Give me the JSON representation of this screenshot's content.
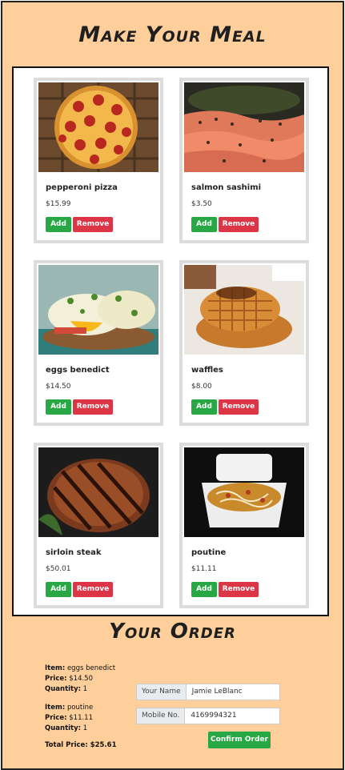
{
  "header": {
    "title": "Make Your Meal"
  },
  "menu": {
    "add_label": "Add",
    "remove_label": "Remove",
    "items": [
      {
        "name": "pepperoni pizza",
        "price": "$15.99"
      },
      {
        "name": "salmon sashimi",
        "price": "$3.50"
      },
      {
        "name": "eggs benedict",
        "price": "$14.50"
      },
      {
        "name": "waffles",
        "price": "$8.00"
      },
      {
        "name": "sirloin steak",
        "price": "$50.01"
      },
      {
        "name": "poutine",
        "price": "$11.11"
      }
    ]
  },
  "order": {
    "title": "Your Order",
    "item_label": "Item:",
    "price_label": "Price:",
    "quantity_label": "Quantity:",
    "lines": [
      {
        "item": "eggs benedict",
        "price": "$14.50",
        "quantity": "1"
      },
      {
        "item": "poutine",
        "price": "$11.11",
        "quantity": "1"
      }
    ],
    "total_label": "Total Price:",
    "total_value": "$25.61",
    "name_label": "Your Name",
    "name_value": "Jamie LeBlanc",
    "mobile_label": "Mobile No.",
    "mobile_value": "4169994321",
    "confirm_label": "Confirm Order"
  }
}
